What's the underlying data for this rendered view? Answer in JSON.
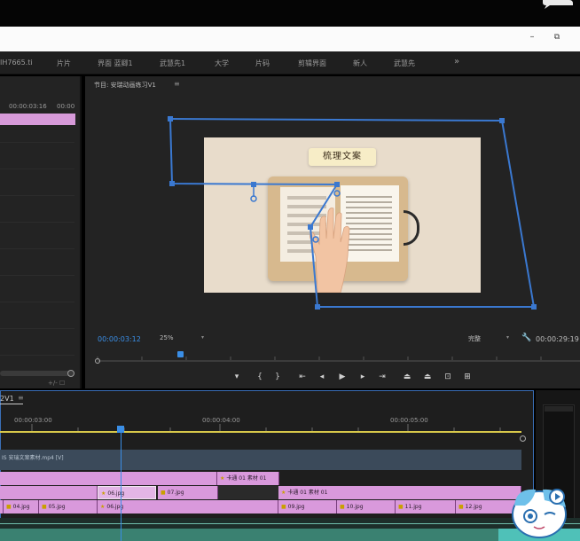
{
  "workspace_tabs": [
    "片片",
    "界面 蓝卿1",
    "武慧先1",
    "大学",
    "片码",
    "剪辑界面",
    "新人",
    "武慧先"
  ],
  "workspace_left_fragment": "IH7665.ti",
  "left_panel": {
    "tc_a": "00:00:03:16",
    "tc_b": "00:00",
    "bottom_icons": "+/- ☐"
  },
  "program_monitor": {
    "title": "节目: 安瑞动画练习V1",
    "menu_icon": "≡",
    "title_card": "梳理文案",
    "current_timecode": "00:00:03:12",
    "zoom": "25%",
    "resolution": "完整",
    "duration": "00:00:29:19"
  },
  "transport": {
    "buttons": [
      "marker-icon",
      "mark-in-icon",
      "mark-out-icon",
      "go-to-in-icon",
      "step-back-icon",
      "play-icon",
      "step-forward-icon",
      "go-to-out-icon",
      "lift-icon",
      "extract-icon",
      "export-frame-icon",
      "settings-icon"
    ],
    "glyphs": [
      "▾",
      "{",
      "}",
      "⇤",
      "◂",
      "▶",
      "▸",
      "⇥",
      "⏏",
      "⏏",
      "⊡",
      "⊞"
    ]
  },
  "timeline": {
    "sequence_tab": "2V1",
    "sequence_menu": "≡",
    "ruler": [
      "00:00:03:00",
      "00:00:04:00",
      "00:00:05:00"
    ],
    "track_high_label": "IS 安瑞文案素材.mp4 [V]",
    "clips_row1": [
      {
        "label": "",
        "kind": "pink"
      },
      {
        "label": "卡通 01 素材 01",
        "kind": "pink-fx"
      }
    ],
    "clips_row2": [
      {
        "label": "",
        "kind": "pink"
      },
      {
        "label": "06.jpg",
        "kind": "sel"
      },
      {
        "label": "07.jpg",
        "kind": "pink-fx"
      },
      {
        "label": "",
        "kind": "dark"
      },
      {
        "label": "卡通 01 素材 01",
        "kind": "pink-fx"
      }
    ],
    "clips_row3": [
      {
        "label": "",
        "kind": "pink"
      },
      {
        "label": "04.jpg",
        "kind": "pink-fx"
      },
      {
        "label": "05.jpg",
        "kind": "pink-fx"
      },
      {
        "label": "06.jpg",
        "kind": "pink-fx"
      },
      {
        "label": "09.jpg",
        "kind": "pink-fx"
      },
      {
        "label": "10.jpg",
        "kind": "pink-fx"
      },
      {
        "label": "11.jpg",
        "kind": "pink-fx"
      },
      {
        "label": "12.jpg",
        "kind": "pink-fx"
      }
    ]
  },
  "window_controls": {
    "minimize": "–",
    "maximize": "⧉"
  },
  "colors": {
    "accent_blue": "#3a8ee6",
    "clip_pink": "#d999dc",
    "work_area": "#d8c84a"
  }
}
